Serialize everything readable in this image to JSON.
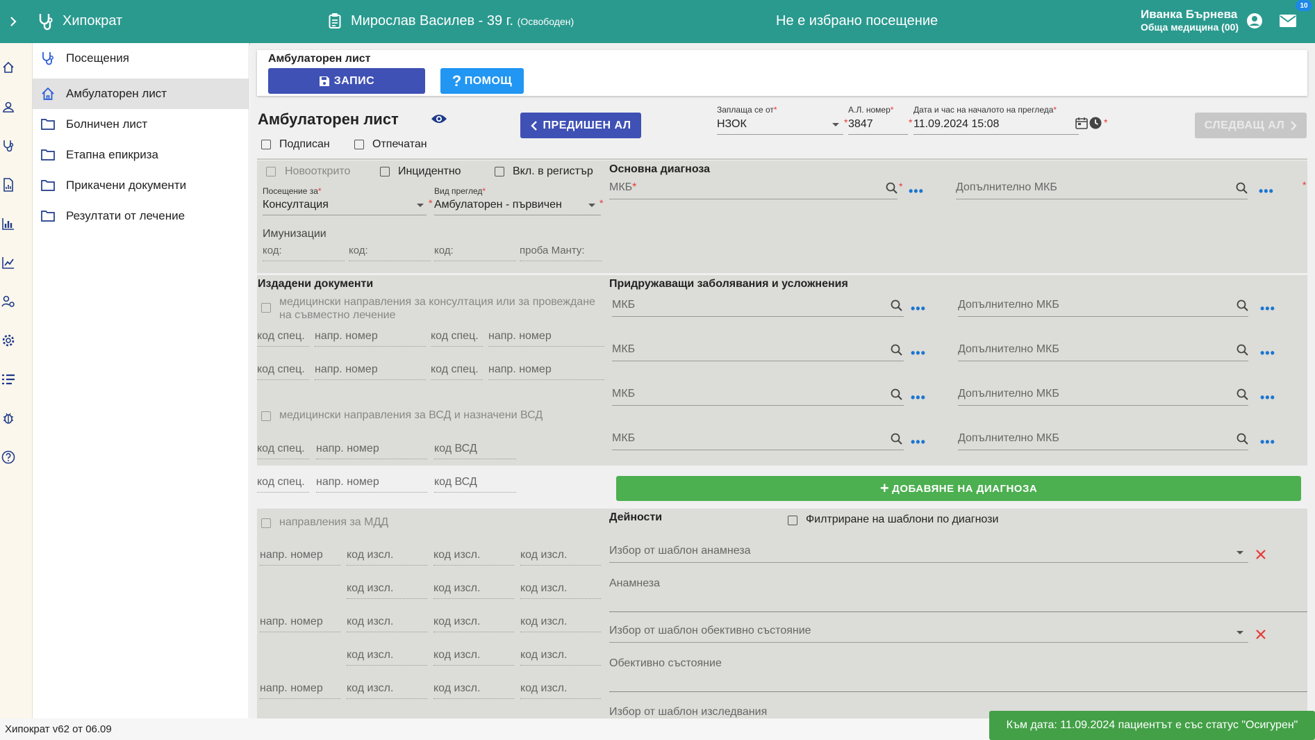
{
  "header": {
    "app_name": "Хипократ",
    "patient": "Мирослав Василев - 39 г.",
    "patient_status": "(Освободен)",
    "visit_status": "Не е избрано посещение",
    "user_name": "Иванка Бърнева",
    "user_role": "Обща медицина (00)",
    "mail_badge": "10"
  },
  "sidebar": {
    "items": [
      {
        "label": "Посещения",
        "icon": "stethoscope-icon"
      },
      {
        "label": "Амбулаторен лист",
        "icon": "home-icon"
      },
      {
        "label": "Болничен лист",
        "icon": "folder-icon"
      },
      {
        "label": "Етапна епикриза",
        "icon": "folder-icon"
      },
      {
        "label": "Прикачени документи",
        "icon": "folder-icon"
      },
      {
        "label": "Резултати от лечение",
        "icon": "folder-icon"
      }
    ]
  },
  "toolbar": {
    "title": "Амбулаторен лист",
    "save_label": "ЗАПИС",
    "help_label": "ПОМОЩ"
  },
  "form": {
    "title": "Амбулаторен лист",
    "prev_label": "ПРЕДИШЕН АЛ",
    "next_label": "СЛЕДВАЩ АЛ",
    "payer_label": "Заплаща се от",
    "payer_value": "НЗОК",
    "number_label": "А.Л. номер",
    "number_value": "3847",
    "datetime_label": "Дата и час на началото на прегледа",
    "datetime_value": "11.09.2024 15:08",
    "signed_label": "Подписан",
    "printed_label": "Отпечатан",
    "new_label": "Новооткрито",
    "incident_label": "Инцидентно",
    "register_label": "Вкл. в регистър",
    "visit_for_label": "Посещение за",
    "visit_for_value": "Консултация",
    "exam_type_label": "Вид преглед",
    "exam_type_value": "Амбулаторен - първичен",
    "immunizations_label": "Имунизации",
    "code_ph": "код:",
    "mantoux_ph": "проба Манту:"
  },
  "diagnosis": {
    "title": "Основна диагноза",
    "mkb_ph": "МКБ",
    "extra_ph": "Допълнително МКБ"
  },
  "comorbid": {
    "title": "Придружаващи заболявания и усложнения",
    "mkb_ph": "МКБ",
    "extra_ph": "Допълнително МКБ",
    "add_label": "ДОБАВЯНЕ НА ДИАГНОЗА"
  },
  "documents": {
    "title": "Издадени документи",
    "consult_label_1": "медицински направления за консултация или за провеждане",
    "consult_label_2": "на съвместно лечение",
    "spec_ph": "код спец.",
    "num_ph": "напр. номер",
    "vsd_label": "медицински направления за ВСД и назначени ВСД",
    "vsd_ph": "код ВСД"
  },
  "mdd": {
    "label": "направления за МДД",
    "num_ph": "напр. номер",
    "code_ph": "код изсл."
  },
  "activities": {
    "title": "Дейности",
    "filter_label": "Филтриране на шаблони по диагнози",
    "anamnesis_template": "Избор от шаблон анамнеза",
    "anamnesis": "Анамнеза",
    "objective_template": "Избор от шаблон обективно състояние",
    "objective": "Обективно състояние",
    "exam_template": "Избор от шаблон изследвания"
  },
  "footer": {
    "version": "Хипократ v62 от 06.09",
    "toast": "Към дата: 11.09.2024 пациентът е със статус \"Осигурен\""
  },
  "colors": {
    "header": "#2a9a8f",
    "primary": "#3f51b5",
    "help": "#2196f3",
    "success": "#4caf50",
    "required": "#e53935",
    "disabled_btn": "#c7c7c7"
  }
}
